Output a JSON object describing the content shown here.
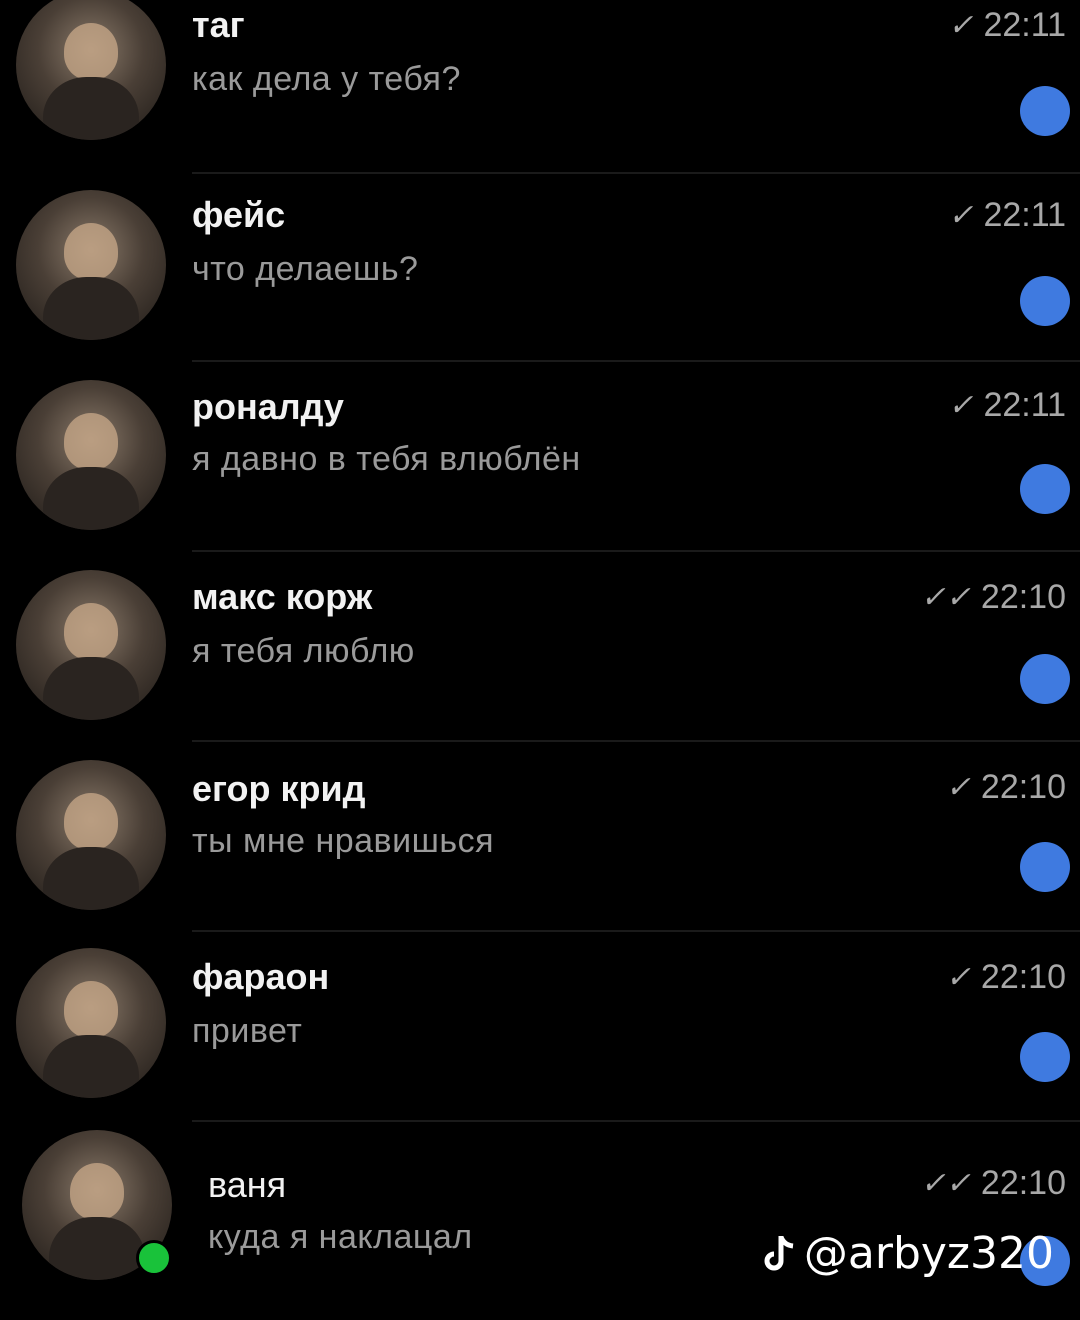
{
  "chats": [
    {
      "name": "таг",
      "message": "как дела у тебя?",
      "time": "22:11",
      "status": "sent-icon",
      "check": "✓",
      "unread": true
    },
    {
      "name": "фейс",
      "message": "что делаешь?",
      "time": "22:11",
      "status": "sent-icon",
      "check": "✓",
      "unread": true
    },
    {
      "name": "роналду",
      "message": "я давно в тебя влюблён",
      "time": "22:11",
      "status": "sent-icon",
      "check": "✓",
      "unread": true
    },
    {
      "name": "макс корж",
      "message": "я тебя люблю",
      "time": "22:10",
      "status": "read-icon",
      "check": "✓✓",
      "unread": true
    },
    {
      "name": "егор крид",
      "message": "ты мне нравишься",
      "time": "22:10",
      "status": "sent-icon",
      "check": "✓",
      "unread": true
    },
    {
      "name": "фараон",
      "message": "привет",
      "time": "22:10",
      "status": "sent-icon",
      "check": "✓",
      "unread": true
    },
    {
      "name": "ваня",
      "message": "куда я наклацал",
      "time": "22:10",
      "status": "read-icon",
      "check": "✓✓",
      "unread": true,
      "online": true
    }
  ],
  "watermark": {
    "icon": "tiktok-icon",
    "handle": "@arbyz320"
  },
  "colors": {
    "background": "#000000",
    "unread_dot": "#3f7ae0",
    "online_dot": "#19c23a",
    "message_text": "#9a9a9a",
    "name_text": "#f2f2f2"
  }
}
